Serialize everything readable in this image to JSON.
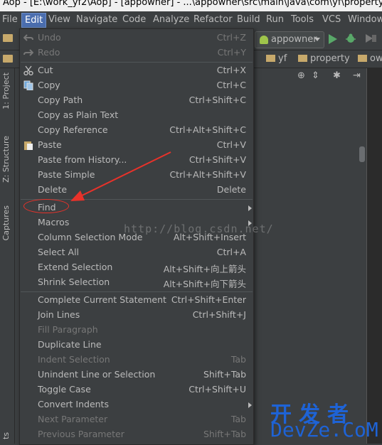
{
  "window": {
    "title": "Aop - [E:\\work_yf2\\Aop] - [appowner] - ...\\appowner\\src\\main\\java\\com\\yf\\property\\ow"
  },
  "menubar": [
    "File",
    "Edit",
    "View",
    "Navigate",
    "Code",
    "Analyze",
    "Refactor",
    "Build",
    "Run",
    "Tools",
    "VCS",
    "Window"
  ],
  "toolbar": {
    "run_config": "appowner",
    "icons": [
      "folder-icon",
      "run-icon",
      "debug-icon",
      "coverage-icon"
    ]
  },
  "breadcrumbs": [
    "yf",
    "property",
    "ow"
  ],
  "sidebar": {
    "tabs": [
      "1: Project",
      "Z: Structure",
      "Captures"
    ],
    "bottom_label": "ts"
  },
  "edit_menu": {
    "items": [
      {
        "label": "Undo",
        "shortcut": "Ctrl+Z",
        "disabled": true,
        "icon": "undo-icon"
      },
      {
        "label": "Redo",
        "shortcut": "Ctrl+Y",
        "disabled": true,
        "icon": "redo-icon"
      },
      {
        "separator": true
      },
      {
        "label": "Cut",
        "shortcut": "Ctrl+X",
        "icon": "scissors-icon"
      },
      {
        "label": "Copy",
        "shortcut": "Ctrl+C",
        "icon": "copy-icon"
      },
      {
        "label": "Copy Path",
        "shortcut": "Ctrl+Shift+C"
      },
      {
        "label": "Copy as Plain Text",
        "shortcut": ""
      },
      {
        "label": "Copy Reference",
        "shortcut": "Ctrl+Alt+Shift+C"
      },
      {
        "label": "Paste",
        "shortcut": "Ctrl+V",
        "icon": "paste-icon"
      },
      {
        "label": "Paste from History...",
        "shortcut": "Ctrl+Shift+V"
      },
      {
        "label": "Paste Simple",
        "shortcut": "Ctrl+Alt+Shift+V"
      },
      {
        "label": "Delete",
        "shortcut": "Delete"
      },
      {
        "separator": true
      },
      {
        "label": "Find",
        "shortcut": "",
        "submenu": true
      },
      {
        "label": "Macros",
        "shortcut": "",
        "submenu": true
      },
      {
        "label": "Column Selection Mode",
        "shortcut": "Alt+Shift+Insert"
      },
      {
        "label": "Select All",
        "shortcut": "Ctrl+A"
      },
      {
        "label": "Extend Selection",
        "shortcut": "Alt+Shift+向上箭头"
      },
      {
        "label": "Shrink Selection",
        "shortcut": "Alt+Shift+向下箭头"
      },
      {
        "separator": true
      },
      {
        "label": "Complete Current Statement",
        "shortcut": "Ctrl+Shift+Enter"
      },
      {
        "label": "Join Lines",
        "shortcut": "Ctrl+Shift+J"
      },
      {
        "label": "Fill Paragraph",
        "shortcut": "",
        "disabled": true
      },
      {
        "label": "Duplicate Line",
        "shortcut": ""
      },
      {
        "label": "Indent Selection",
        "shortcut": "Tab",
        "disabled": true
      },
      {
        "label": "Unindent Line or Selection",
        "shortcut": "Shift+Tab"
      },
      {
        "label": "Toggle Case",
        "shortcut": "Ctrl+Shift+U"
      },
      {
        "label": "Convert Indents",
        "shortcut": "",
        "submenu": true
      },
      {
        "label": "Next Parameter",
        "shortcut": "Tab",
        "disabled": true
      },
      {
        "label": "Previous Parameter",
        "shortcut": "Shift+Tab",
        "disabled": true
      }
    ]
  },
  "annotations": {
    "watermark": "http://blog.csdn.net/",
    "logo_cn": "开发者",
    "logo_en": "DevZe.CoM",
    "highlight_color": "#e8322a"
  }
}
